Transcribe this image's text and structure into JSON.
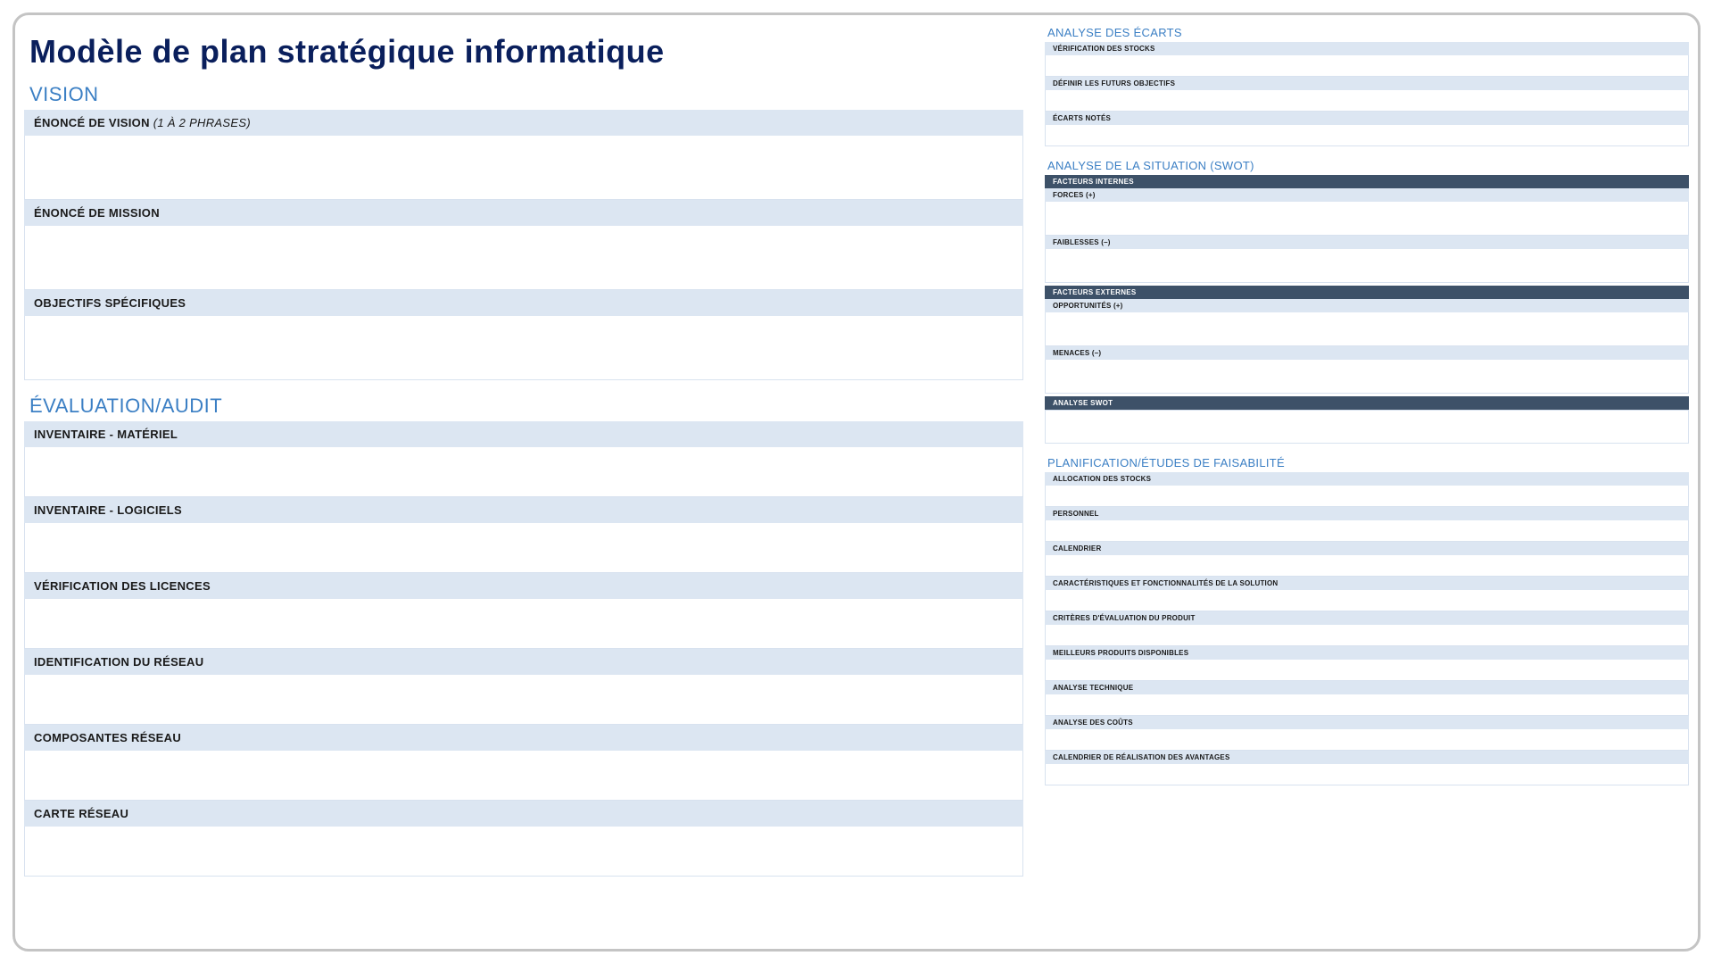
{
  "title": "Modèle de plan stratégique informatique",
  "left": {
    "vision": {
      "title": "VISION",
      "rows": [
        {
          "label": "ÉNONCÉ DE VISION",
          "hint": " (1 À 2 PHRASES)"
        },
        {
          "label": "ÉNONCÉ DE MISSION",
          "hint": ""
        },
        {
          "label": "OBJECTIFS SPÉCIFIQUES",
          "hint": ""
        }
      ]
    },
    "audit": {
      "title": "ÉVALUATION/AUDIT",
      "rows": [
        {
          "label": "INVENTAIRE - MATÉRIEL"
        },
        {
          "label": "INVENTAIRE - LOGICIELS"
        },
        {
          "label": "VÉRIFICATION DES LICENCES"
        },
        {
          "label": "IDENTIFICATION DU RÉSEAU"
        },
        {
          "label": "COMPOSANTES RÉSEAU"
        },
        {
          "label": "CARTE RÉSEAU"
        }
      ]
    }
  },
  "right": {
    "gap_analysis": {
      "title": "ANALYSE DES ÉCARTS",
      "rows": [
        {
          "label": "VÉRIFICATION DES STOCKS"
        },
        {
          "label": "DÉFINIR LES FUTURS OBJECTIFS"
        },
        {
          "label": "ÉCARTS NOTÉS"
        }
      ]
    },
    "swot": {
      "title": "ANALYSE DE LA SITUATION (SWOT)",
      "internal_header": "FACTEURS INTERNES",
      "internal": [
        {
          "label": "FORCES (+)"
        },
        {
          "label": "FAIBLESSES (–)"
        }
      ],
      "external_header": "FACTEURS EXTERNES",
      "external": [
        {
          "label": "OPPORTUNITÉS (+)"
        },
        {
          "label": "MENACES (–)"
        }
      ],
      "analysis_header": "ANALYSE SWOT"
    },
    "feasibility": {
      "title": "PLANIFICATION/ÉTUDES DE FAISABILITÉ",
      "rows": [
        {
          "label": "ALLOCATION DES STOCKS"
        },
        {
          "label": "PERSONNEL"
        },
        {
          "label": "CALENDRIER"
        },
        {
          "label": "CARACTÉRISTIQUES ET FONCTIONNALITÉS DE LA SOLUTION"
        },
        {
          "label": "CRITÈRES D'ÉVALUATION DU PRODUIT"
        },
        {
          "label": "MEILLEURS PRODUITS DISPONIBLES"
        },
        {
          "label": "ANALYSE TECHNIQUE"
        },
        {
          "label": "ANALYSE DES COÛTS"
        },
        {
          "label": "CALENDRIER DE RÉALISATION DES AVANTAGES"
        }
      ]
    }
  }
}
